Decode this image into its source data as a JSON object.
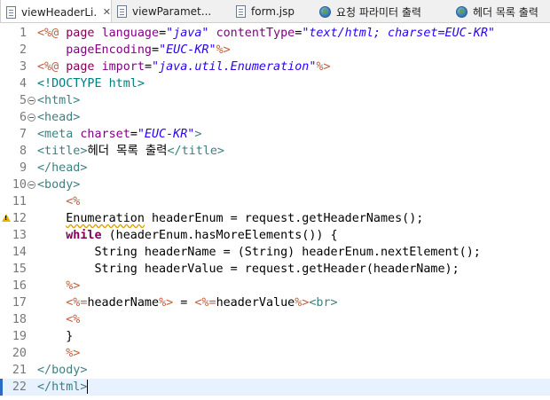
{
  "tabs": [
    {
      "label": "viewHeaderLi...",
      "icon": "jsp-file-icon",
      "active": true,
      "close": "✕"
    },
    {
      "label": "viewParamet...",
      "icon": "jsp-file-icon",
      "active": false
    },
    {
      "label": "form.jsp",
      "icon": "jsp-file-icon",
      "active": false
    },
    {
      "label": "요청 파라미터 출력",
      "icon": "globe-icon",
      "active": false
    },
    {
      "label": "헤더 목록 출력",
      "icon": "globe-icon",
      "active": false
    }
  ],
  "colors": {
    "directive": "#bf5f3f",
    "keyword": "#7f0055",
    "tag": "#3f7f7f",
    "attr": "#7f007f",
    "string": "#2a00ff",
    "text": "#000000",
    "doctype": "#008080"
  },
  "editor": {
    "current_line": 22,
    "lines": [
      {
        "n": "1",
        "fold": false,
        "warn": false,
        "tokens": [
          {
            "t": "<%@ ",
            "c": "directive"
          },
          {
            "t": "page ",
            "c": "keyword"
          },
          {
            "t": "language",
            "c": "attr"
          },
          {
            "t": "=",
            "c": "text"
          },
          {
            "t": "\"java\"",
            "c": "string",
            "i": true
          },
          {
            "t": " ",
            "c": "text"
          },
          {
            "t": "contentType",
            "c": "attr"
          },
          {
            "t": "=",
            "c": "text"
          },
          {
            "t": "\"text/html; charset=EUC-KR\"",
            "c": "string",
            "i": true
          }
        ]
      },
      {
        "n": "2",
        "fold": false,
        "warn": false,
        "tokens": [
          {
            "t": "    pageEncoding",
            "c": "attr"
          },
          {
            "t": "=",
            "c": "text"
          },
          {
            "t": "\"EUC-KR\"",
            "c": "string",
            "i": true
          },
          {
            "t": "%>",
            "c": "directive"
          }
        ]
      },
      {
        "n": "3",
        "fold": false,
        "warn": false,
        "tokens": [
          {
            "t": "<%@ ",
            "c": "directive"
          },
          {
            "t": "page ",
            "c": "keyword"
          },
          {
            "t": "import",
            "c": "attr"
          },
          {
            "t": "=",
            "c": "text"
          },
          {
            "t": "\"java.util.Enumeration\"",
            "c": "string",
            "i": true
          },
          {
            "t": "%>",
            "c": "directive"
          }
        ]
      },
      {
        "n": "4",
        "fold": false,
        "warn": false,
        "tokens": [
          {
            "t": "<!DOCTYPE html>",
            "c": "doctype"
          }
        ]
      },
      {
        "n": "5",
        "fold": true,
        "warn": false,
        "tokens": [
          {
            "t": "<html>",
            "c": "tag"
          }
        ]
      },
      {
        "n": "6",
        "fold": true,
        "warn": false,
        "tokens": [
          {
            "t": "<head>",
            "c": "tag"
          }
        ]
      },
      {
        "n": "7",
        "fold": false,
        "warn": false,
        "tokens": [
          {
            "t": "<meta ",
            "c": "tag"
          },
          {
            "t": "charset",
            "c": "attr"
          },
          {
            "t": "=",
            "c": "text"
          },
          {
            "t": "\"EUC-KR\"",
            "c": "string",
            "i": true
          },
          {
            "t": ">",
            "c": "tag"
          }
        ]
      },
      {
        "n": "8",
        "fold": false,
        "warn": false,
        "tokens": [
          {
            "t": "<title>",
            "c": "tag"
          },
          {
            "t": "헤더 목록 출력",
            "c": "text"
          },
          {
            "t": "</title>",
            "c": "tag"
          }
        ]
      },
      {
        "n": "9",
        "fold": false,
        "warn": false,
        "tokens": [
          {
            "t": "</head>",
            "c": "tag"
          }
        ]
      },
      {
        "n": "10",
        "fold": true,
        "warn": false,
        "tokens": [
          {
            "t": "<body>",
            "c": "tag"
          }
        ]
      },
      {
        "n": "11",
        "fold": false,
        "warn": false,
        "tokens": [
          {
            "t": "    ",
            "c": "text"
          },
          {
            "t": "<%",
            "c": "directive"
          }
        ]
      },
      {
        "n": "12",
        "fold": false,
        "warn": true,
        "tokens": [
          {
            "t": "    ",
            "c": "text"
          },
          {
            "t": "Enumeration",
            "c": "text",
            "sq": true
          },
          {
            "t": " headerEnum = request.getHeaderNames();",
            "c": "text"
          }
        ]
      },
      {
        "n": "13",
        "fold": false,
        "warn": false,
        "tokens": [
          {
            "t": "    ",
            "c": "text"
          },
          {
            "t": "while",
            "c": "keyword",
            "b": true
          },
          {
            "t": " (headerEnum.hasMoreElements()) {",
            "c": "text"
          }
        ]
      },
      {
        "n": "14",
        "fold": false,
        "warn": false,
        "tokens": [
          {
            "t": "        String headerName = (String) headerEnum.nextElement();",
            "c": "text"
          }
        ]
      },
      {
        "n": "15",
        "fold": false,
        "warn": false,
        "tokens": [
          {
            "t": "        String headerValue = request.getHeader(headerName);",
            "c": "text"
          }
        ]
      },
      {
        "n": "16",
        "fold": false,
        "warn": false,
        "tokens": [
          {
            "t": "    ",
            "c": "text"
          },
          {
            "t": "%>",
            "c": "directive"
          }
        ]
      },
      {
        "n": "17",
        "fold": false,
        "warn": false,
        "tokens": [
          {
            "t": "    ",
            "c": "text"
          },
          {
            "t": "<%=",
            "c": "directive"
          },
          {
            "t": "headerName",
            "c": "text"
          },
          {
            "t": "%>",
            "c": "directive"
          },
          {
            "t": " = ",
            "c": "text"
          },
          {
            "t": "<%=",
            "c": "directive"
          },
          {
            "t": "headerValue",
            "c": "text"
          },
          {
            "t": "%>",
            "c": "directive"
          },
          {
            "t": "<br>",
            "c": "tag"
          }
        ]
      },
      {
        "n": "18",
        "fold": false,
        "warn": false,
        "tokens": [
          {
            "t": "    ",
            "c": "text"
          },
          {
            "t": "<%",
            "c": "directive"
          }
        ]
      },
      {
        "n": "19",
        "fold": false,
        "warn": false,
        "tokens": [
          {
            "t": "    }",
            "c": "text"
          }
        ]
      },
      {
        "n": "20",
        "fold": false,
        "warn": false,
        "tokens": [
          {
            "t": "    ",
            "c": "text"
          },
          {
            "t": "%>",
            "c": "directive"
          }
        ]
      },
      {
        "n": "21",
        "fold": false,
        "warn": false,
        "tokens": [
          {
            "t": "</body>",
            "c": "tag"
          }
        ]
      },
      {
        "n": "22",
        "fold": false,
        "warn": false,
        "tokens": [
          {
            "t": "</html>",
            "c": "tag"
          }
        ]
      }
    ]
  }
}
